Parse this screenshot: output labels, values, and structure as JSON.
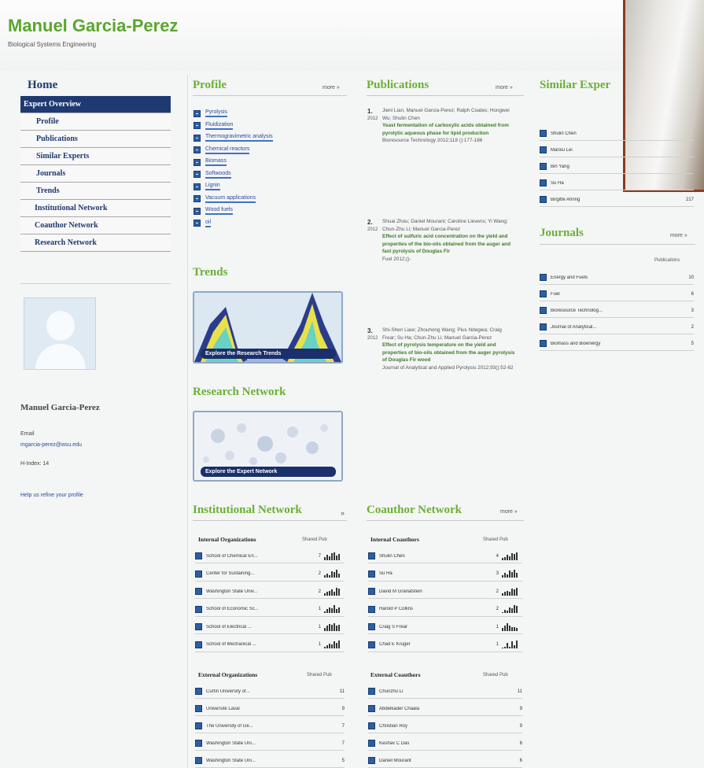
{
  "header": {
    "name": "Manuel Garcia-Perez",
    "department": "Biological Systems Engineering"
  },
  "nav": {
    "home": "Home",
    "items": [
      {
        "label": "Expert Overview",
        "active": true
      },
      {
        "label": "Profile"
      },
      {
        "label": "Publications"
      },
      {
        "label": "Similar Experts"
      },
      {
        "label": "Journals"
      },
      {
        "label": "Trends"
      },
      {
        "label": "Institutional Network"
      },
      {
        "label": "Coauthor Network"
      },
      {
        "label": "Research Network"
      }
    ]
  },
  "card": {
    "name": "Manuel Garcia-Perez",
    "email_label": "Email",
    "email": "mgarcia-perez@wsu.edu",
    "h_index": "H-Index: 14",
    "refine": "Help us refine your profile"
  },
  "profile": {
    "title": "Profile",
    "more": "more »",
    "keywords": [
      "Pyrolysis",
      "Fluidization",
      "Thermogravimetric analysis",
      "Chemical reactors",
      "Biomass",
      "Softwoods",
      "Lignin",
      "Vacuum applications",
      "Wood fuels",
      "oil"
    ]
  },
  "trends": {
    "title": "Trends",
    "button": "Explore the Research Trends"
  },
  "research_network": {
    "title": "Research Network",
    "button": "Explore the Expert Network"
  },
  "publications": {
    "title": "Publications",
    "more": "more »",
    "items": [
      {
        "num": "1.",
        "year": "2012",
        "authors": "Jieni Lian, Manuel Garcia-Perez; Ralph Coates; Hongwei Wu; Shulin Chen",
        "title": "Yeast fermentation of carboxylic acids obtained from pyrolytic aqueous phase for lipid production",
        "source": "Bioresource Technology 2012;118 ():177-186"
      },
      {
        "num": "2.",
        "year": "2012",
        "authors": "Shuai Zhou; Daniel Mourant; Caroline Lievens; Yi Wang; Chun-Zhu Li; Manuel Garcia-Perez",
        "title": "Effect of sulfuric acid concentration on the yield and properties of the bio-oils obtained from the auger and fast pyrolysis of Douglas Fir",
        "source": "Fuel 2012;()-"
      },
      {
        "num": "3.",
        "year": "2012",
        "authors": "Shi-Shen Liaw; Zhouhong Wang; Pius Ndegwa; Craig Frear; Su Ha; Chun-Zhu Li; Manuel Garcia-Perez",
        "title": "Effect of pyrolysis temperature on the yield and properties of bio-oils obtained from the auger pyrolysis of Douglas Fir wood",
        "source": "Journal of Analytical and Applied Pyrolysis 2012;93():52-62"
      }
    ]
  },
  "similar_experts": {
    "title": "Similar Exper",
    "items": [
      {
        "name": "Shulin Chen"
      },
      {
        "name": "Manxu Lei"
      },
      {
        "name": "Bin Yang"
      },
      {
        "name": "Su Ha"
      },
      {
        "name": "Birgitte Ahring",
        "count": "217"
      }
    ]
  },
  "journals": {
    "title": "Journals",
    "more": "more »",
    "col_label": "Publications",
    "items": [
      {
        "name": "Energy and Fuels",
        "count": "10"
      },
      {
        "name": "Fuel",
        "count": "6"
      },
      {
        "name": "Bioresource Technolog...",
        "count": "3"
      },
      {
        "name": "Journal of Analytical...",
        "count": "2"
      },
      {
        "name": "Biomass and Bioenergy",
        "count": "5"
      }
    ]
  },
  "institutional": {
    "title": "Institutional Network",
    "arrow": "»",
    "internal_head": "Internal Organizations",
    "shared_label": "Shared Pub",
    "internal": [
      {
        "name": "School of Chemical En...",
        "count": "7",
        "spark": [
          3,
          6,
          4,
          8,
          9,
          5,
          7
        ]
      },
      {
        "name": "Center for Sustaining...",
        "count": "2",
        "spark": [
          2,
          3,
          2,
          5,
          4,
          6,
          3
        ]
      },
      {
        "name": "Washington State Univ...",
        "count": "2",
        "spark": [
          2,
          3,
          4,
          5,
          3,
          7,
          6
        ]
      },
      {
        "name": "School of Economic Sc...",
        "count": "1",
        "spark": [
          2,
          4,
          6,
          5,
          8,
          4,
          6
        ]
      },
      {
        "name": "School of Electrical ...",
        "count": "1",
        "spark": [
          3,
          5,
          7,
          6,
          8,
          5,
          6
        ]
      },
      {
        "name": "School of Mechanical ...",
        "count": "1",
        "spark": [
          2,
          3,
          5,
          4,
          7,
          6,
          8
        ]
      }
    ],
    "external_head": "External Organizations",
    "external": [
      {
        "name": "Curtin University of...",
        "count": "11"
      },
      {
        "name": "Université Laval",
        "count": "9"
      },
      {
        "name": "The University of Ge...",
        "count": "7"
      },
      {
        "name": "Washington State Uni...",
        "count": "7"
      },
      {
        "name": "Washington State Uni...",
        "count": "5"
      }
    ]
  },
  "coauthor": {
    "title": "Coauthor Network",
    "more": "more »",
    "internal_head": "Internal Coauthors",
    "shared_label": "Shared Pub",
    "internal": [
      {
        "name": "Shulin Chen",
        "count": "4",
        "spark": [
          2,
          3,
          5,
          4,
          7,
          6,
          8
        ]
      },
      {
        "name": "Su Ha",
        "count": "3",
        "spark": [
          2,
          4,
          3,
          6,
          5,
          7,
          4
        ]
      },
      {
        "name": "David M Granatstein",
        "count": "2",
        "spark": [
          2,
          3,
          4,
          3,
          6,
          5,
          7
        ]
      },
      {
        "name": "Harold P Collins",
        "count": "2",
        "spark": [
          1,
          3,
          2,
          5,
          4,
          7,
          6
        ]
      },
      {
        "name": "Craig S Frear",
        "count": "1",
        "spark": [
          2,
          4,
          6,
          4,
          3,
          3,
          2
        ]
      },
      {
        "name": "Chad E Kruger",
        "count": "1",
        "spark": [
          1,
          2,
          6,
          2,
          7,
          3,
          8
        ]
      }
    ],
    "external_head": "External Coauthors",
    "external": [
      {
        "name": "Chunzhu Li",
        "count": "11"
      },
      {
        "name": "Abdelkader Chaala",
        "count": "9"
      },
      {
        "name": "Christian Roy",
        "count": "9"
      },
      {
        "name": "Keshav C Das",
        "count": "6"
      },
      {
        "name": "Daniel Mourant",
        "count": "6"
      }
    ]
  }
}
